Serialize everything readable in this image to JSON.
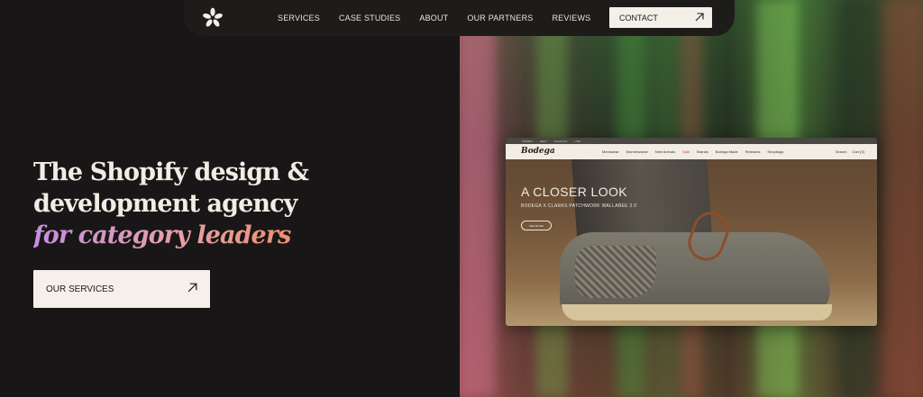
{
  "nav": {
    "links": [
      "SERVICES",
      "CASE STUDIES",
      "ABOUT",
      "OUR PARTNERS",
      "REVIEWS"
    ],
    "contact_label": "CONTACT"
  },
  "hero": {
    "line1": "The Shopify design &",
    "line2": "development agency",
    "accent": "for category leaders",
    "cta_label": "OUR SERVICES"
  },
  "mockup": {
    "top_links": [
      "WOMEN",
      "HELP",
      "ACCOUNT",
      "USD"
    ],
    "logo": "Bodega",
    "menu": [
      "Menswear",
      "Womenswear",
      "New Arrivals",
      "Sale",
      "Brands",
      "Bodega Made",
      "Releases",
      "Shopbags"
    ],
    "right_links": [
      "Search",
      "Cart (0)"
    ],
    "heading": "A CLOSER LOOK",
    "subheading": "BODEGA X CLARKS PATCHWORK WALLABEE 3.0",
    "button_label": "SEE MORE"
  },
  "colors": {
    "background": "#181616",
    "nav_background": "#1d1c1b",
    "button_background": "#f5f0e9",
    "accent_gradient_start": "#c58ee0",
    "accent_gradient_end": "#ed8b62"
  },
  "icons": {
    "logo": "asterisk-flower-icon",
    "contact_arrow": "arrow-up-right-icon",
    "services_arrow": "arrow-up-right-icon"
  }
}
